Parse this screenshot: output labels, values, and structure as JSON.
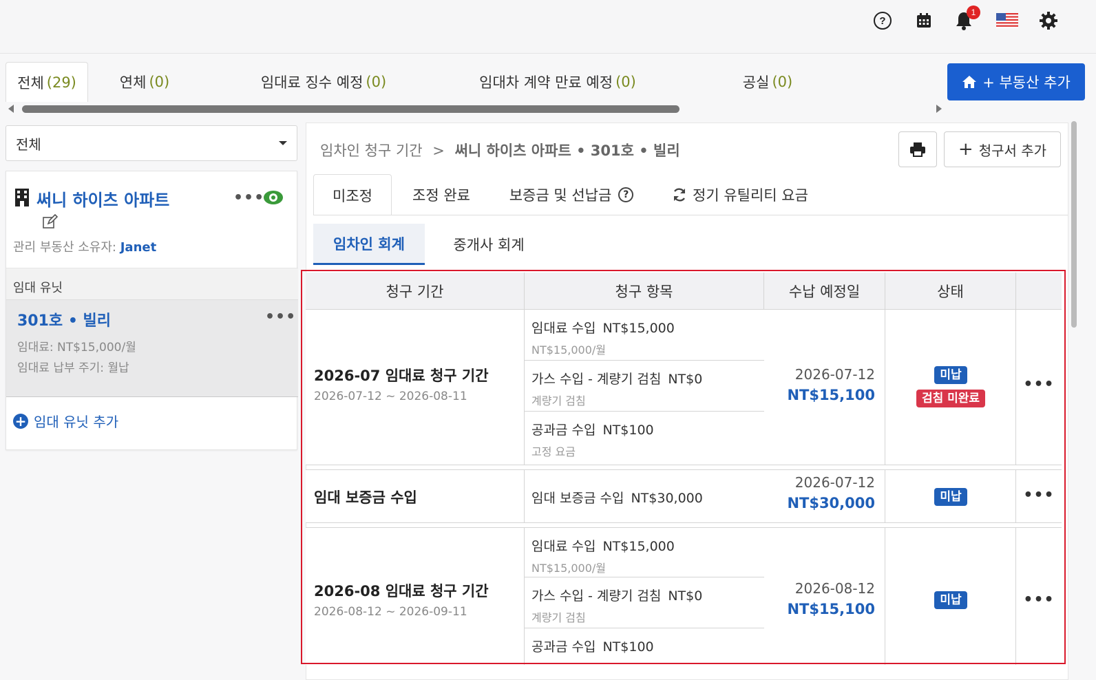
{
  "topbar": {
    "help_icon": "question-circle-icon",
    "calendar_icon": "calendar-icon",
    "bell_icon": "bell-icon",
    "notification_count": "1",
    "flag_icon": "us-flag-icon",
    "gear_icon": "gear-icon"
  },
  "property_tabs": [
    {
      "label": "전체",
      "count": "(29)"
    },
    {
      "label": "연체",
      "count": "(0)"
    },
    {
      "label": "임대료 징수 예정",
      "count": "(0)"
    },
    {
      "label": "임대차 계약 만료 예정",
      "count": "(0)"
    },
    {
      "label": "공실",
      "count": "(0)"
    }
  ],
  "add_property_label": "+ 부동산 추가",
  "left": {
    "filter_value": "전체",
    "property": {
      "name": "써니 하이츠 아파트",
      "owner_label": "관리 부동산 소유자:",
      "owner_name": "Janet"
    },
    "units_header": "임대 유닛",
    "unit": {
      "name": "301호 • 빌리",
      "rent": "임대료: NT$15,000/월",
      "cycle": "임대료 납부 주기: 월납"
    },
    "add_unit_label": "임대 유닛 추가"
  },
  "right": {
    "breadcrumb_part1": "임차인 청구 기간",
    "breadcrumb_sep": ">",
    "breadcrumb_part2": "써니 하이츠 아파트 • 301호 • 빌리",
    "add_invoice_label": "청구서 추가",
    "tabs": [
      "미조정",
      "조정 완료",
      "보증금 및 선납금",
      "정기 유틸리티 요금"
    ],
    "account_tabs": [
      "임차인 회계",
      "중개사 회계"
    ]
  },
  "table": {
    "headers": [
      "청구 기간",
      "청구 항목",
      "수납 예정일",
      "상태"
    ],
    "rows": [
      {
        "title": "2026-07 임대료 청구 기간",
        "range": "2026-07-12 ~ 2026-08-11",
        "items": [
          {
            "name": "임대료 수입",
            "amount": "NT$15,000",
            "sub": "NT$15,000/월"
          },
          {
            "name": "가스 수입 - 계량기 검침",
            "amount": "NT$0",
            "sub": "계량기 검침"
          },
          {
            "name": "공과금 수입",
            "amount": "NT$100",
            "sub": "고정 요금"
          }
        ],
        "due_date": "2026-07-12",
        "due_amount": "NT$15,100",
        "status": [
          "미납",
          "검침 미완료"
        ]
      },
      {
        "title": "임대 보증금 수입",
        "range": "",
        "items": [
          {
            "name": "임대 보증금 수입",
            "amount": "NT$30,000",
            "sub": ""
          }
        ],
        "due_date": "2026-07-12",
        "due_amount": "NT$30,000",
        "status": [
          "미납"
        ]
      },
      {
        "title": "2026-08 임대료 청구 기간",
        "range": "2026-08-12 ~ 2026-09-11",
        "items": [
          {
            "name": "임대료 수입",
            "amount": "NT$15,000",
            "sub": "NT$15,000/월"
          },
          {
            "name": "가스 수입 - 계량기 검침",
            "amount": "NT$0",
            "sub": "계량기 검침"
          },
          {
            "name": "공과금 수입",
            "amount": "NT$100",
            "sub": ""
          }
        ],
        "due_date": "2026-08-12",
        "due_amount": "NT$15,100",
        "status": [
          "미납"
        ]
      }
    ]
  },
  "colors": {
    "primary": "#1a5fd0",
    "link": "#1f5fb8",
    "unpaid_badge": "#1f5fb8",
    "meter_badge": "#d9364a",
    "count_green": "#7a8a20",
    "highlight_border": "#d9182b"
  }
}
